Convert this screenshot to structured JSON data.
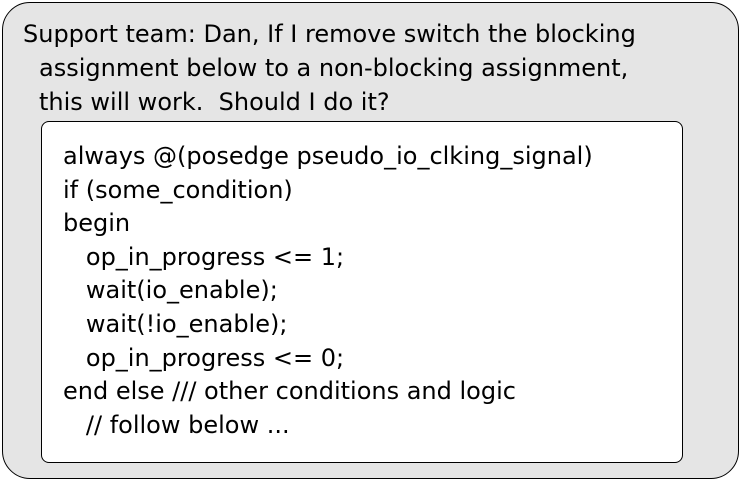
{
  "message": {
    "lines": [
      "Support team: Dan, If I remove switch the blocking",
      "assignment below to a non-blocking assignment,",
      "this will work.  Should I do it?"
    ]
  },
  "code": {
    "lines": [
      "always @(posedge pseudo_io_clking_signal)",
      "if (some_condition)",
      "begin",
      "   op_in_progress <= 1;",
      "   wait(io_enable);",
      "   wait(!io_enable);",
      "   op_in_progress <= 0;",
      "end else /// other conditions and logic",
      "   // follow below ..."
    ]
  }
}
